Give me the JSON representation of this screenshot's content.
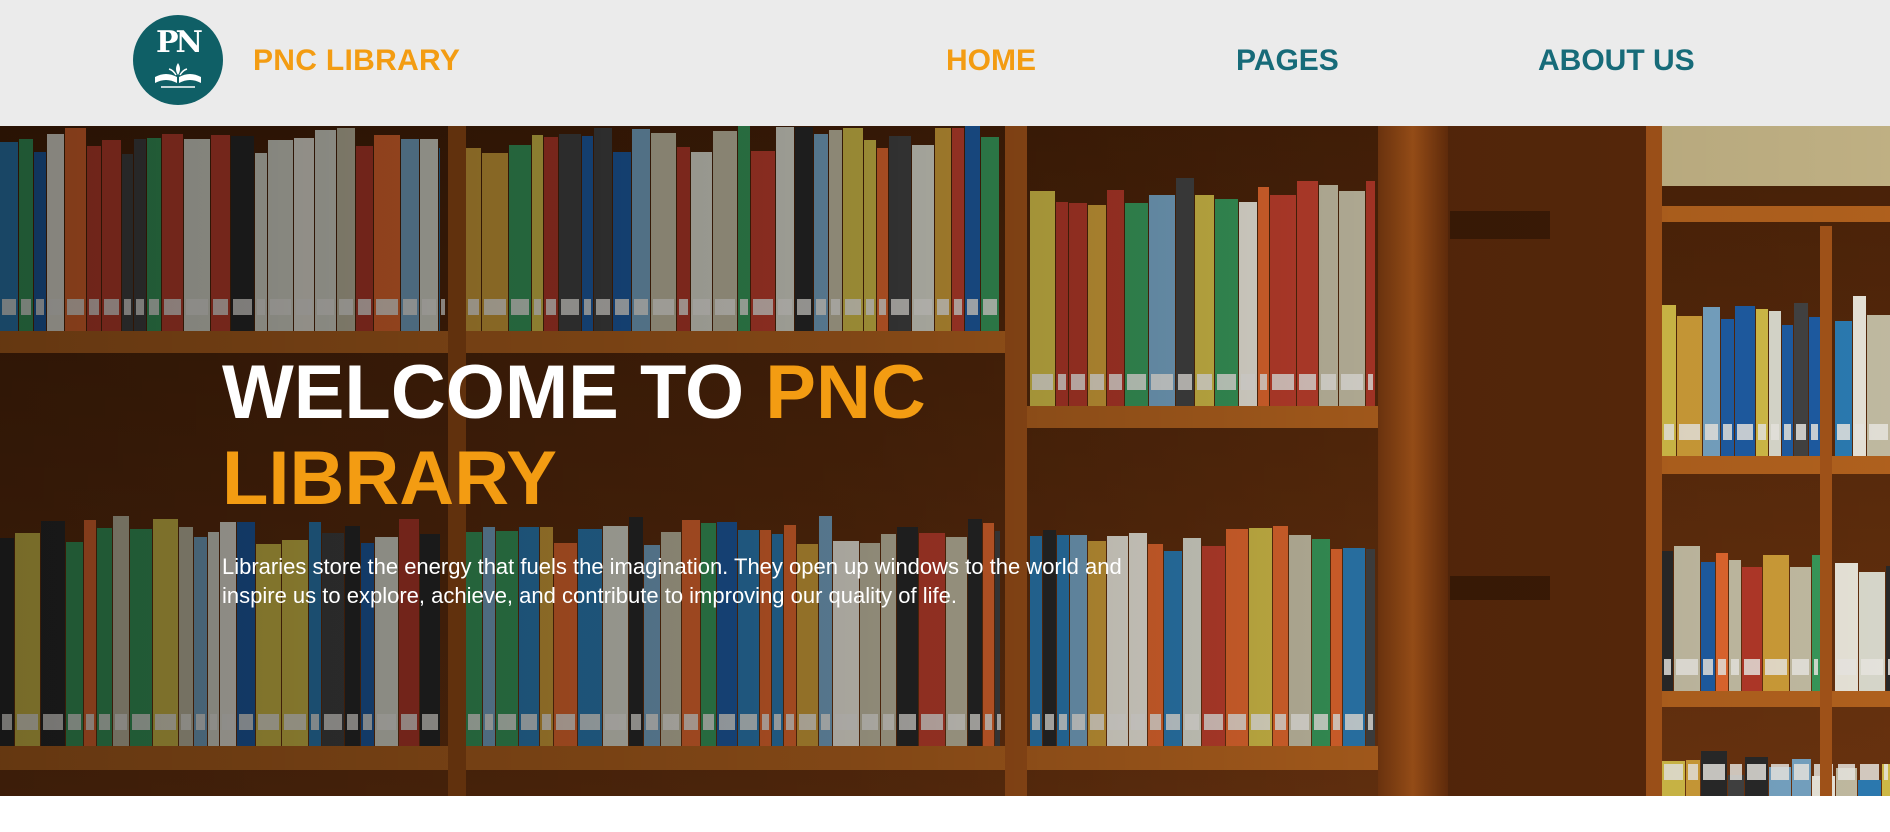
{
  "navbar": {
    "logo_text": "PN",
    "brand": "PNC LIBRARY",
    "links": [
      {
        "label": "HOME",
        "active": true
      },
      {
        "label": "PAGES",
        "active": false
      },
      {
        "label": "ABOUT US",
        "active": false
      }
    ]
  },
  "hero": {
    "title_part1": "WELCOME TO ",
    "title_part2": "PNC LIBRARY",
    "description": "Libraries store the energy that fuels the imagination. They open up windows to the world and inspire us to explore, achieve, and contribute to improving our quality of life.",
    "background": "library-bookshelves-photo"
  },
  "colors": {
    "accent": "#f39c12",
    "nav_link": "#176b79",
    "logo_bg": "#0f5f66",
    "navbar_bg": "#ebebeb"
  }
}
